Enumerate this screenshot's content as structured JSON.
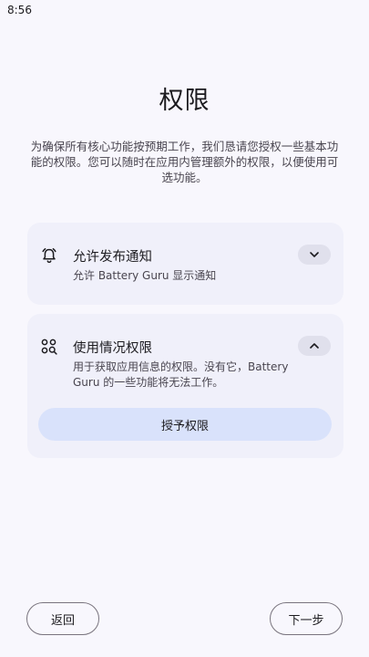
{
  "status_bar": {
    "time": "8:56"
  },
  "header": {
    "title": "权限",
    "description": "为确保所有核心功能按预期工作，我们恳请您授权一些基本功能的权限。您可以随时在应用内管理额外的权限，以便使用可选功能。"
  },
  "permissions": [
    {
      "icon": "bell-icon",
      "title": "允许发布通知",
      "subtitle": "允许 Battery Guru 显示通知",
      "expanded": false
    },
    {
      "icon": "usage-search-icon",
      "title": "使用情况权限",
      "subtitle": "用于获取应用信息的权限。没有它，Battery Guru 的一些功能将无法工作。",
      "expanded": true,
      "action_label": "授予权限"
    }
  ],
  "footer": {
    "back_label": "返回",
    "next_label": "下一步"
  },
  "colors": {
    "background": "#f8f7fd",
    "card": "#f0f0fa",
    "grant_button": "#d9e2fb"
  }
}
